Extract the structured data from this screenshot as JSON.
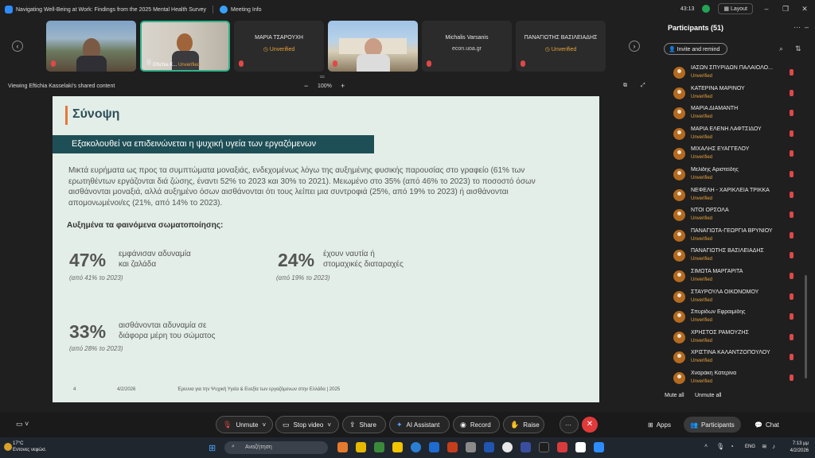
{
  "titlebar": {
    "meeting_title": "Navigating Well-Being at Work: Findings from the 2025 Mental Health Survey",
    "meeting_info": "Meeting Info",
    "timer": "43:13",
    "layout": "Layout"
  },
  "strip": {
    "tiles": [
      {
        "name": "",
        "sub": ""
      },
      {
        "name": "",
        "label": "Eftichia K...",
        "label_status": "Unverified"
      },
      {
        "name": "ΜΑΡΙΑ ΤΣΑΡΟΥΧΗ",
        "unverified": "Unverified"
      },
      {
        "name": ""
      },
      {
        "name": "Michalis Varsanis",
        "sub": "econ.uoa.gr"
      },
      {
        "name": "ΠΑΝΑΓΙΩΤΗΣ ΒΑΣΙΛΕΙΑΔΗΣ",
        "unverified": "Unverified"
      }
    ]
  },
  "share": {
    "viewing": "Viewing Eftichia Kasselaki's shared content",
    "zoom": "100%"
  },
  "slide": {
    "title": "Σύνοψη",
    "banner": "Εξακολουθεί να επιδεινώνεται η ψυχική υγεία των εργαζόμενων",
    "paragraph": "Μικτά ευρήματα ως προς τα συμπτώματα μοναξιάς, ενδεχομένως λόγω της αυξημένης φυσικής παρουσίας στο γραφείο (61% των ερωτηθέντων εργάζονται διά ζώσης, έναντι 52% το 2023 και 30% το 2021). Μειωμένο στο 35% (από 46% το 2023) το ποσοστό όσων αισθάνονται μοναξιά, αλλά αυξημένο όσων αισθάνονται ότι τους λείπει μια συντροφιά (25%, από 19% το 2023) ή αισθάνονται απομονωμένοι/ες (21%, από 14% το 2023).",
    "subheading": "Αυξημένα τα φαινόμενα σωματοποίησης:",
    "stats": [
      {
        "value": "47%",
        "line1": "εμφάνισαν αδυναμία",
        "line2": "και ζαλάδα",
        "prev": "(από 41% το 2023)"
      },
      {
        "value": "24%",
        "line1": "έχουν ναυτία ή",
        "line2": "στομαχικές διαταραχές",
        "prev": "(από 19% το 2023)"
      },
      {
        "value": "33%",
        "line1": "αισθάνονται αδυναμία σε",
        "line2": "διάφορα μέρη του σώματος",
        "prev": "(από 28% το 2023)"
      }
    ],
    "footer": {
      "page": "4",
      "date": "4/2/2026",
      "source": "Έρευνα για την Ψυχική Υγεία & Ευεξία των εργαζόμενων στην Ελλάδα | 2025"
    }
  },
  "panel": {
    "title": "Participants (51)",
    "invite": "Invite and remind",
    "unverified": "Unverified",
    "participants": [
      "ΙΑΣΩΝ ΣΠΥΡΙΔΩΝ ΠΑΛΑΙΟΛΟ...",
      "ΚΑΤΕΡΙΝΑ ΜΑΡΙΝΟΥ",
      "ΜΑΡΙΑ ΔΙΑΜΑΝΤΗ",
      "ΜΑΡΙΑ ΕΛΕΝΗ ΛΑΦΤΣΙΔΟΥ",
      "ΜΙΧΑΛΗΣ ΕΥΑΓΓΕΛΟΥ",
      "Μελίδης Αριστείδης",
      "ΝΕΦΕΛΗ - ΧΑΡΙΚΛΕΙΑ ΤΡΙΚΚΑ",
      "ΝΤΟΪ ΟΡΣΟΛΑ",
      "ΠΑΝΑΓΙΩΤΑ-ΓΕΩΡΓΙΑ ΒΡΥΝΙΟΥ",
      "ΠΑΝΑΓΙΩΤΗΣ ΒΑΣΙΛΕΙΑΔΗΣ",
      "ΣΙΜΩΤΑ ΜΑΡΓΑΡΙΤΑ",
      "ΣΤΑΥΡΟΥΛΑ ΟΙΚΟΝΟΜΟΥ",
      "Σπυρίδων Εφραιμίδης",
      "ΧΡΗΣΤΟΣ ΡΑΜΟΥΖΗΣ",
      "ΧΡΙΣΤΙΝΑ ΚΑΛΑΝΤΖΟΠΟΥΛΟΥ",
      "Χναράκη Κατερίνα"
    ],
    "mute_all": "Mute all",
    "unmute_all": "Unmute all"
  },
  "toolbar": {
    "unmute": "Unmute",
    "stop_video": "Stop video",
    "share": "Share",
    "ai_assistant": "AI Assistant",
    "record": "Record",
    "raise": "Raise",
    "more": "···",
    "apps": "Apps",
    "participants": "Participants",
    "chat": "Chat"
  },
  "taskbar": {
    "temp": "17°C",
    "weather": "Εντονες νεφώσ.",
    "search": "Αναζήτηση",
    "lang": "ENG",
    "time": "7:13 μμ",
    "date": "4/2/2026"
  }
}
